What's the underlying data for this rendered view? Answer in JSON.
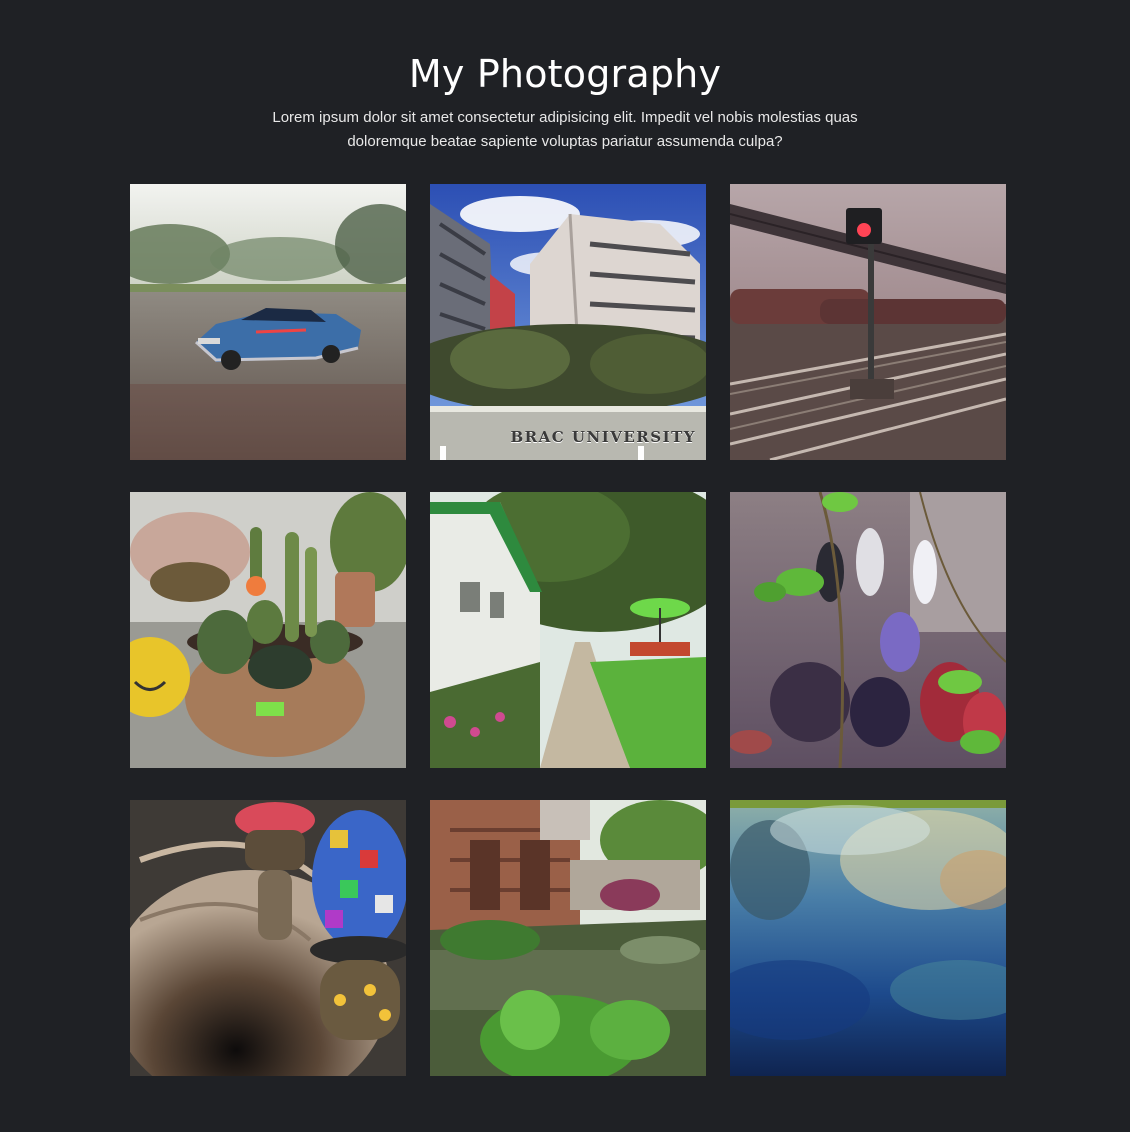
{
  "header": {
    "title": "My Photography",
    "subtitle": "Lorem ipsum dolor sit amet consectetur adipisicing elit. Impedit vel nobis molestias quas doloremque beatae sapiente voluptas pariatur assumenda culpa?"
  },
  "gallery": {
    "photos": [
      {
        "subject": "toy-car-on-road"
      },
      {
        "subject": "university-building",
        "sign_text": "BRAC UNIVERSITY"
      },
      {
        "subject": "railway-signal-tracks"
      },
      {
        "subject": "potted-cactus"
      },
      {
        "subject": "garden-walkway"
      },
      {
        "subject": "crowd-through-vines"
      },
      {
        "subject": "mosaic-lamps-gramophone"
      },
      {
        "subject": "pond-garden-building"
      },
      {
        "subject": "blue-water-reflection"
      }
    ]
  }
}
